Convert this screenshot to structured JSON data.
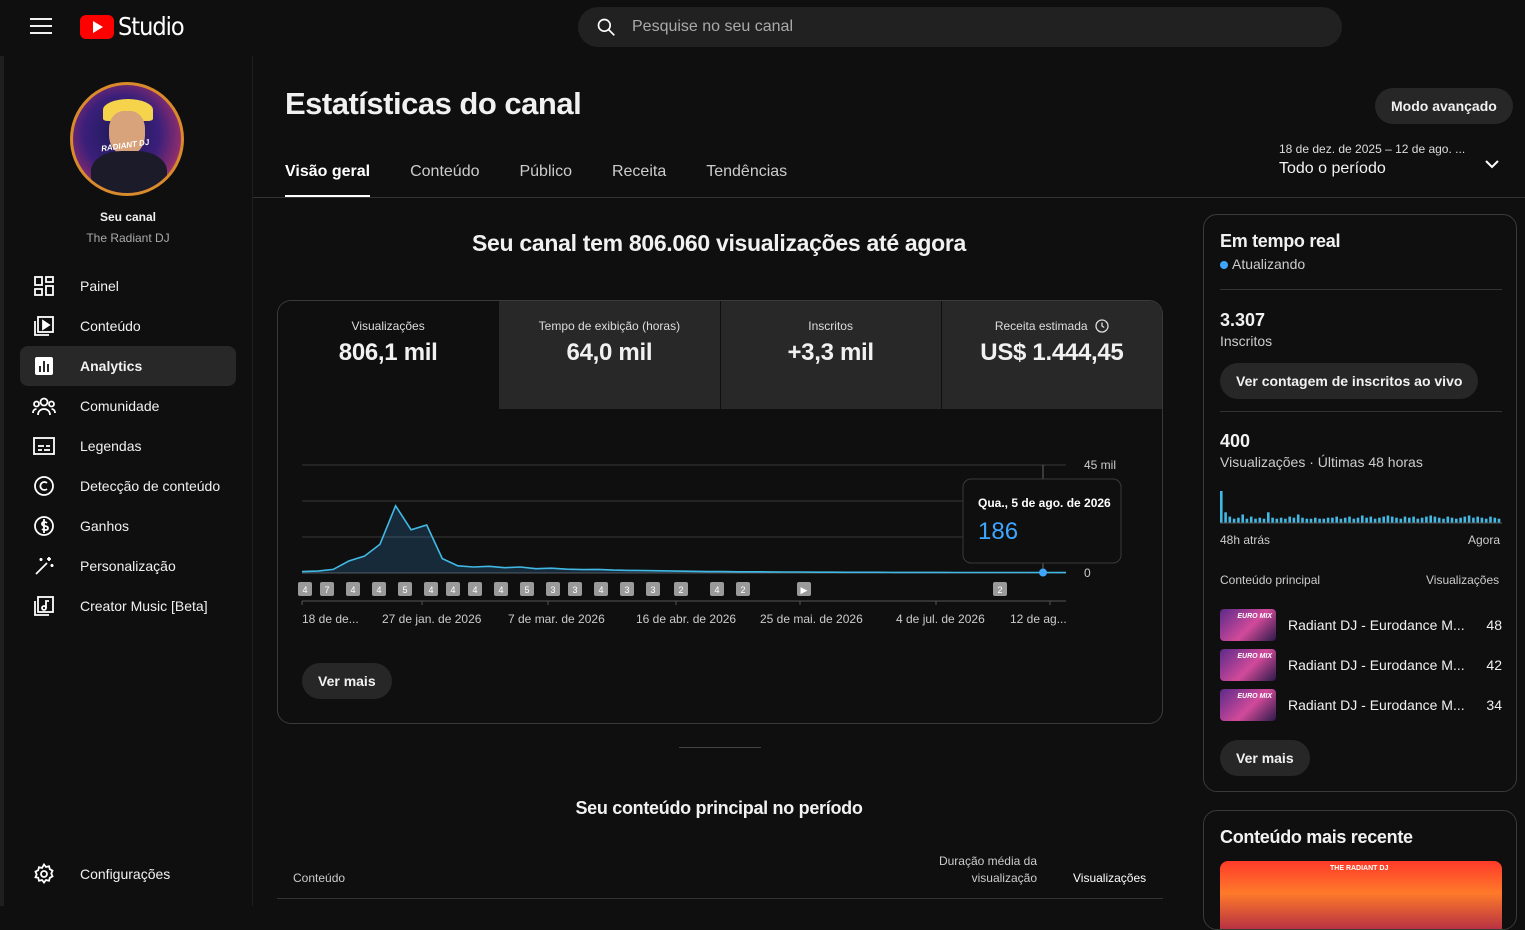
{
  "app": {
    "logo_text": "Studio"
  },
  "search": {
    "placeholder": "Pesquise no seu canal"
  },
  "channel": {
    "label": "Seu canal",
    "name": "The Radiant DJ",
    "avatar_text": "RADIANT DJ"
  },
  "sidebar": {
    "items": [
      {
        "label": "Painel",
        "icon": "dashboard-icon"
      },
      {
        "label": "Conteúdo",
        "icon": "content-icon"
      },
      {
        "label": "Analytics",
        "icon": "analytics-icon",
        "active": true
      },
      {
        "label": "Comunidade",
        "icon": "community-icon"
      },
      {
        "label": "Legendas",
        "icon": "subtitles-icon"
      },
      {
        "label": "Detecção de conteúdo",
        "icon": "copyright-icon"
      },
      {
        "label": "Ganhos",
        "icon": "earn-icon"
      },
      {
        "label": "Personalização",
        "icon": "magic-wand-icon"
      },
      {
        "label": "Creator Music [Beta]",
        "icon": "music-icon"
      }
    ],
    "settings": "Configurações"
  },
  "header": {
    "title": "Estatísticas do canal",
    "advanced_mode": "Modo avançado",
    "range_dates": "18 de dez. de 2025 – 12 de ago. ...",
    "range_label": "Todo o período"
  },
  "tabs": [
    "Visão geral",
    "Conteúdo",
    "Público",
    "Receita",
    "Tendências"
  ],
  "overview": {
    "headline": "Seu canal tem 806.060 visualizações até agora",
    "metrics": [
      {
        "label": "Visualizações",
        "value": "806,1 mil"
      },
      {
        "label": "Tempo de exibição (horas)",
        "value": "64,0 mil"
      },
      {
        "label": "Inscritos",
        "value": "+3,3 mil"
      },
      {
        "label": "Receita estimada",
        "value": "US$ 1.444,45"
      }
    ],
    "see_more": "Ver mais"
  },
  "chart_data": {
    "type": "area",
    "y_ticks": [
      "45 mil",
      "0"
    ],
    "ylim": [
      0,
      45000
    ],
    "x_tick_labels": [
      "18 de de...",
      "27 de jan. de 2026",
      "7 de mar. de 2026",
      "16 de abr. de 2026",
      "25 de mai. de 2026",
      "4 de jul. de 2026",
      "12 de ag..."
    ],
    "series": [
      {
        "values": [
          600,
          800,
          1500,
          5000,
          7000,
          12000,
          28000,
          18000,
          20000,
          6000,
          3000,
          2500,
          2800,
          2200,
          2500,
          1800,
          2000,
          1600,
          1400,
          1500,
          1200,
          1100,
          1000,
          900,
          800,
          700,
          600,
          600,
          500,
          500,
          450,
          400,
          400,
          350,
          350,
          300,
          300,
          280,
          260,
          250,
          240,
          230,
          220,
          220,
          210,
          200,
          200,
          190,
          190,
          186
        ]
      }
    ],
    "tooltip": {
      "date": "Qua., 5 de ago. de 2026",
      "value": "186"
    },
    "markers": [
      "4",
      "7",
      "4",
      "4",
      "5",
      "4",
      "4",
      "4",
      "4",
      "5",
      "3",
      "3",
      "4",
      "3",
      "3",
      "2",
      "4",
      "2",
      "▶",
      "2"
    ],
    "grid": true
  },
  "top_content": {
    "title": "Seu conteúdo principal no período",
    "col_content": "Conteúdo",
    "col_avg": "Duração média da visualização",
    "col_views": "Visualizações"
  },
  "realtime": {
    "title": "Em tempo real",
    "updating": "Atualizando",
    "subs_value": "3.307",
    "subs_label": "Inscritos",
    "live_button": "Ver contagem de inscritos ao vivo",
    "views_value": "400",
    "views_label": "Visualizações · Últimas 48 horas",
    "spark_left": "48h atrás",
    "spark_right": "Agora",
    "spark_values": [
      30,
      10,
      6,
      4,
      5,
      8,
      4,
      6,
      4,
      5,
      4,
      10,
      5,
      4,
      5,
      4,
      6,
      5,
      8,
      5,
      4,
      4,
      5,
      4,
      4,
      5,
      5,
      6,
      4,
      5,
      6,
      4,
      5,
      7,
      5,
      6,
      4,
      5,
      6,
      7,
      6,
      5,
      4,
      6,
      5,
      6,
      4,
      5,
      6,
      7,
      6,
      5,
      4,
      6,
      5,
      4,
      5,
      6,
      7,
      5,
      6,
      5,
      4,
      6,
      5,
      4
    ],
    "top_header": "Conteúdo principal",
    "top_views_header": "Visualizações",
    "top_items": [
      {
        "name": "Radiant DJ - Eurodance M...",
        "views": "48",
        "thumb_text": "EURO MIX"
      },
      {
        "name": "Radiant DJ - Eurodance M...",
        "views": "42",
        "thumb_text": "EURO MIX"
      },
      {
        "name": "Radiant DJ - Eurodance M...",
        "views": "34",
        "thumb_text": "EURO MIX"
      }
    ],
    "see_more": "Ver mais"
  },
  "recent": {
    "title": "Conteúdo mais recente",
    "thumb_text": "THE RADIANT DJ"
  }
}
